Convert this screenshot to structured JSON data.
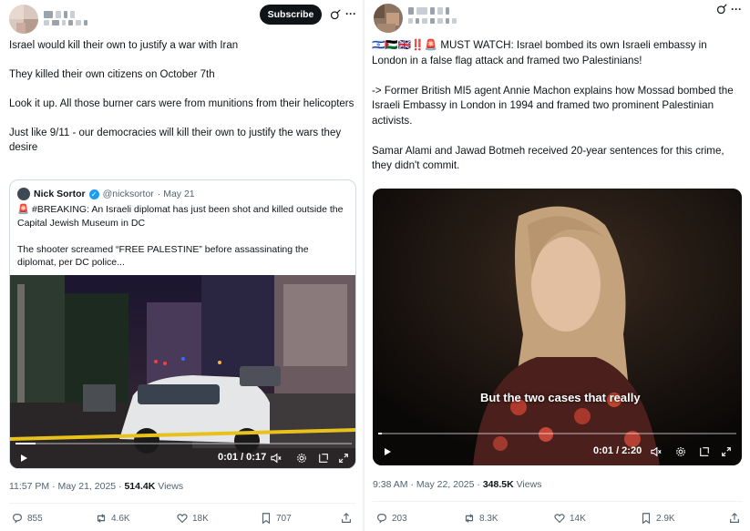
{
  "left_post": {
    "subscribe_label": "Subscribe",
    "body": "Israel would kill their own to justify a war with Iran\n\nThey killed their own citizens on October 7th\n\nLook it up. All those burner cars were from munitions from their helicopters\n\nJust like 9/11 - our democracies will kill their own to justify the wars they desire",
    "quote": {
      "author_name": "Nick Sortor",
      "handle": "@nicksortor",
      "date": "· May 21",
      "text": "🚨 #BREAKING: An Israeli diplomat has just been shot and killed outside the Capital Jewish Museum in DC\n\nThe shooter screamed “FREE PALESTINE” before assassinating the diplomat, per DC police..."
    },
    "video": {
      "time": "0:01 / 0:17",
      "progress": 0.06
    },
    "timestamp": "11:57 PM · May 21, 2025 ·",
    "views_count": "514.4K",
    "views_label": "Views",
    "actions": {
      "replies": "855",
      "reposts": "4.6K",
      "likes": "18K",
      "bookmarks": "707"
    }
  },
  "right_post": {
    "body": "🇮🇱🇵🇸🇬🇧‼️🚨 MUST WATCH: Israel bombed its own Israeli embassy in London in a false flag attack and framed two Palestinians!\n\n-> Former British MI5 agent Annie Machon explains how Mossad bombed the Israeli Embassy in London in 1994 and framed two prominent Palestinian activists.\n\nSamar Alami and Jawad Botmeh received 20-year sentences for this crime, they didn't commit.",
    "video": {
      "subtitle": "But the two cases that really",
      "time": "0:01 / 2:20",
      "progress": 0.01
    },
    "timestamp": "9:38 AM · May 22, 2025 ·",
    "views_count": "348.5K",
    "views_label": "Views",
    "actions": {
      "replies": "203",
      "reposts": "8.3K",
      "likes": "14K",
      "bookmarks": "2.9K"
    }
  },
  "icons": {
    "grok": "grok-icon",
    "more": "more-icon",
    "play": "play-icon",
    "volume": "volume-icon",
    "settings": "gear-icon",
    "minimize": "minimize-player-icon",
    "fullscreen": "fullscreen-icon",
    "reply": "reply-icon",
    "repost": "repost-icon",
    "like": "like-icon",
    "bookmark": "bookmark-icon",
    "share": "share-icon"
  },
  "colors": {
    "accent": "#1d9bf0",
    "text": "#0f1419",
    "muted": "#536471",
    "border": "#cfd9de"
  }
}
